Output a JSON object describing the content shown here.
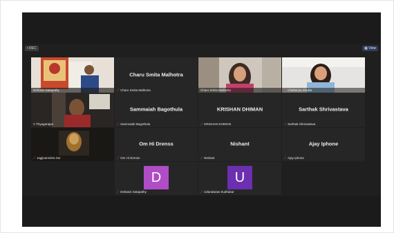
{
  "toolbar": {
    "left_label": "• REC",
    "right_label": "▦ View"
  },
  "participants": [
    {
      "id": "p1",
      "name": "Debasis Satapathy",
      "type": "video"
    },
    {
      "id": "p2",
      "name": "Charu Smita Malhotra",
      "type": "name"
    },
    {
      "id": "p3",
      "name": "Charu Smita Malhotra",
      "type": "video"
    },
    {
      "id": "p4",
      "name": "Chaitanya Shukla",
      "type": "video"
    },
    {
      "id": "p5",
      "name": "V Thyagarajan",
      "type": "video"
    },
    {
      "id": "p6",
      "name": "Sammaiah Bagothula",
      "type": "name"
    },
    {
      "id": "p7",
      "name": "KRISHAN DHIMAN",
      "type": "name"
    },
    {
      "id": "p8",
      "name": "Sarthak Shrivastava",
      "type": "name"
    },
    {
      "id": "p9",
      "name": "Jagjivanmitra Ssr",
      "type": "video"
    },
    {
      "id": "p10",
      "name": "Om Hi Drenss",
      "type": "name"
    },
    {
      "id": "p11",
      "name": "Nishant",
      "type": "name"
    },
    {
      "id": "p12",
      "name": "Ajay Iphone",
      "type": "name"
    },
    {
      "id": "p13",
      "name": "Debasis Satapathy",
      "type": "avatar",
      "initial": "D",
      "avatar_color": "#b04cc6"
    },
    {
      "id": "p14",
      "name": "Udandaraw Sudhakar",
      "type": "avatar",
      "initial": "U",
      "avatar_color": "#6b2fb0"
    }
  ]
}
